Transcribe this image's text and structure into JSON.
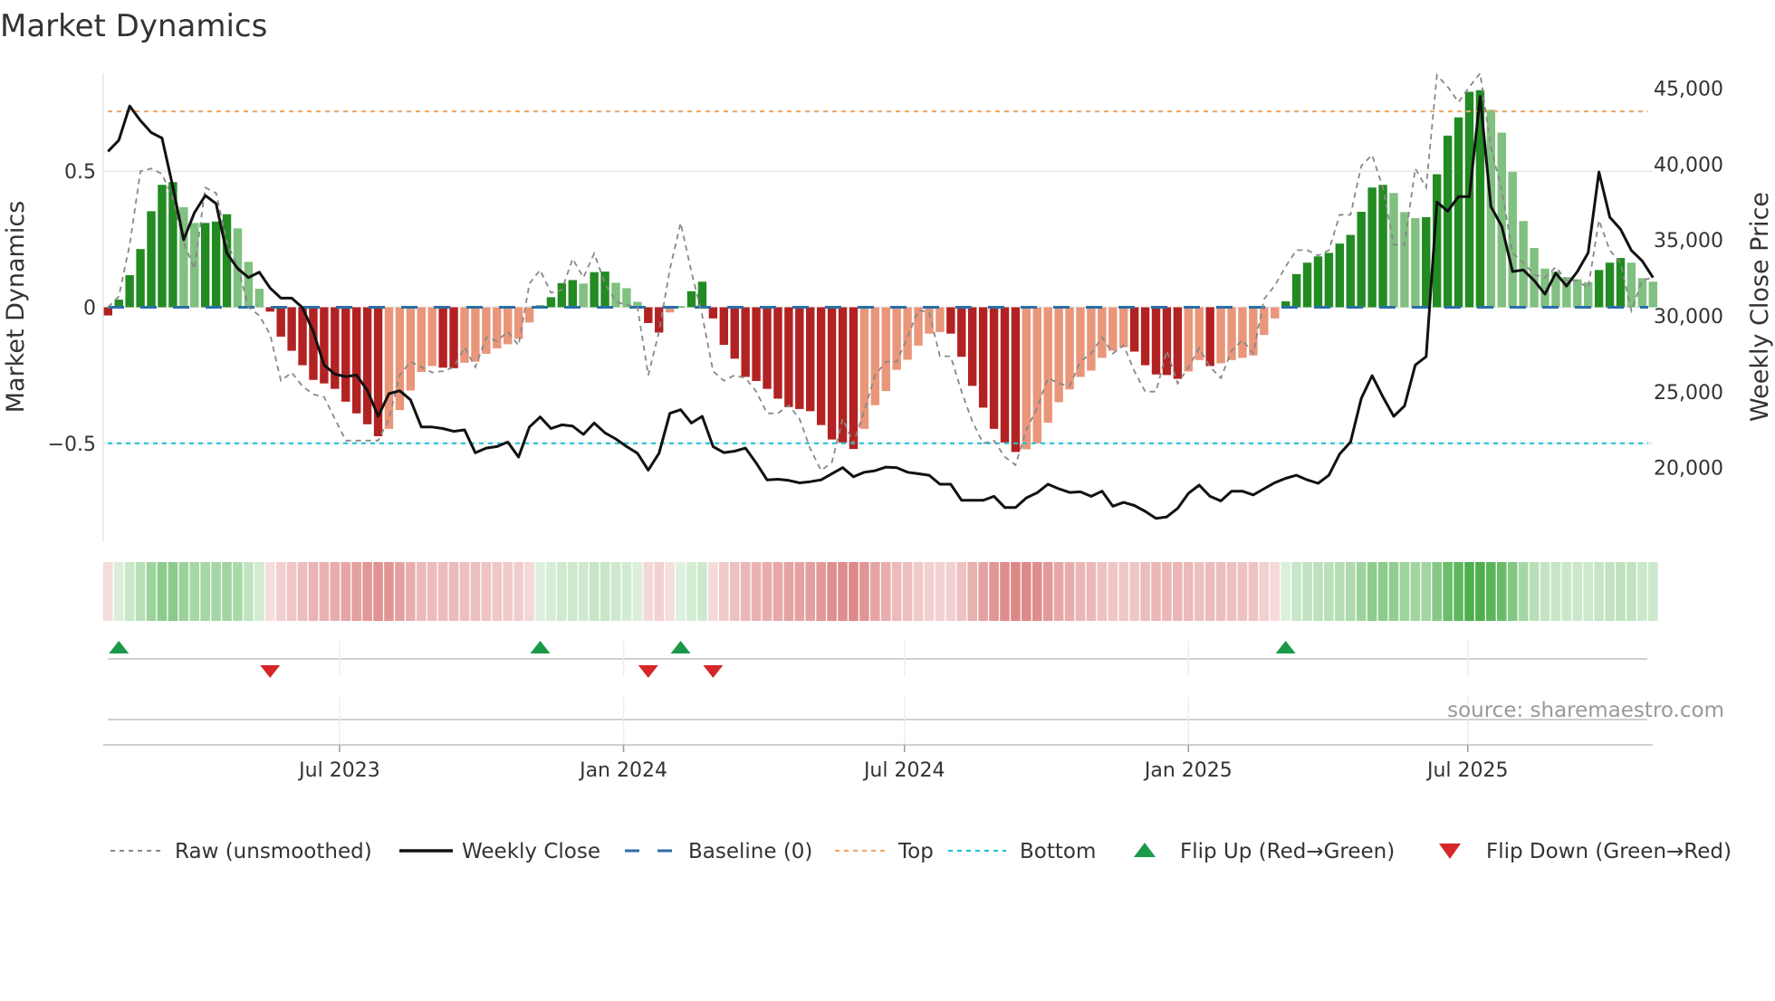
{
  "chart_data": {
    "type": "bar",
    "title": "Market Dynamics",
    "ylabel": "Market Dynamics",
    "y2label": "Weekly Close Price",
    "source": "source: sharemaestro.com",
    "week_start": "2023-02-01",
    "x_step_days": 7,
    "ylim": [
      -0.86,
      0.86
    ],
    "y2lim": [
      15155,
      45978
    ],
    "yticks": [
      {
        "v": 0.5,
        "label": "0.5"
      },
      {
        "v": 0,
        "label": "0"
      },
      {
        "v": -0.5,
        "label": "−0.5"
      }
    ],
    "y2ticks": [
      {
        "v": 45000,
        "label": "45,000"
      },
      {
        "v": 40000,
        "label": "40,000"
      },
      {
        "v": 35000,
        "label": "35,000"
      },
      {
        "v": 30000,
        "label": "30,000"
      },
      {
        "v": 25000,
        "label": "25,000"
      },
      {
        "v": 20000,
        "label": "20,000"
      }
    ],
    "xticks": [
      {
        "date": "2023-07-01",
        "label": "Jul 2023"
      },
      {
        "date": "2024-01-01",
        "label": "Jan 2024"
      },
      {
        "date": "2024-07-01",
        "label": "Jul 2024"
      },
      {
        "date": "2025-01-01",
        "label": "Jan 2025"
      },
      {
        "date": "2025-07-01",
        "label": "Jul 2025"
      }
    ],
    "top_level": 0.72,
    "bottom_level": -0.5,
    "baseline": 0,
    "colors": {
      "green_dark": "#228b22",
      "green_light": "#80c080",
      "red_dark": "#b22222",
      "red_light": "#e9967a",
      "top": "#f0a868",
      "bottom": "#22c4d8",
      "baseline": "#2a6fa8",
      "raw": "#888888",
      "close": "#111111",
      "flip_up": "#1a9a48",
      "flip_down": "#d62728"
    },
    "series": [
      {
        "name": "Market Dynamics",
        "kind": "bar",
        "values": [
          -0.03,
          0.028,
          0.118,
          0.214,
          0.353,
          0.45,
          0.46,
          0.368,
          0.31,
          0.31,
          0.315,
          0.342,
          0.29,
          0.167,
          0.068,
          -0.016,
          -0.108,
          -0.16,
          -0.213,
          -0.267,
          -0.28,
          -0.3,
          -0.347,
          -0.39,
          -0.43,
          -0.474,
          -0.447,
          -0.378,
          -0.306,
          -0.238,
          -0.216,
          -0.222,
          -0.224,
          -0.204,
          -0.2,
          -0.171,
          -0.151,
          -0.136,
          -0.116,
          -0.056,
          0.007,
          0.037,
          0.089,
          0.1,
          0.087,
          0.129,
          0.131,
          0.09,
          0.07,
          0.02,
          -0.058,
          -0.093,
          -0.019,
          0.003,
          0.059,
          0.094,
          -0.041,
          -0.138,
          -0.189,
          -0.256,
          -0.271,
          -0.3,
          -0.336,
          -0.367,
          -0.374,
          -0.382,
          -0.433,
          -0.486,
          -0.497,
          -0.521,
          -0.447,
          -0.36,
          -0.308,
          -0.23,
          -0.193,
          -0.141,
          -0.097,
          -0.091,
          -0.097,
          -0.182,
          -0.289,
          -0.369,
          -0.447,
          -0.497,
          -0.532,
          -0.522,
          -0.5,
          -0.424,
          -0.349,
          -0.302,
          -0.256,
          -0.233,
          -0.186,
          -0.16,
          -0.147,
          -0.163,
          -0.213,
          -0.247,
          -0.249,
          -0.263,
          -0.236,
          -0.194,
          -0.216,
          -0.206,
          -0.194,
          -0.186,
          -0.177,
          -0.102,
          -0.041,
          0.022,
          0.122,
          0.164,
          0.187,
          0.2,
          0.234,
          0.266,
          0.351,
          0.44,
          0.45,
          0.42,
          0.35,
          0.328,
          0.331,
          0.489,
          0.631,
          0.698,
          0.792,
          0.798,
          0.726,
          0.642,
          0.498,
          0.317,
          0.218,
          0.142,
          0.131,
          0.111,
          0.103,
          0.092,
          0.137,
          0.164,
          0.181,
          0.164,
          0.107,
          0.094
        ]
      },
      {
        "name": "Raw (unsmoothed)",
        "kind": "line",
        "values": [
          0,
          0.04,
          0.23,
          0.5,
          0.51,
          0.49,
          0.4,
          0.24,
          0.14,
          0.44,
          0.42,
          0.24,
          0.15,
          0,
          -0.03,
          -0.1,
          -0.27,
          -0.24,
          -0.29,
          -0.32,
          -0.33,
          -0.41,
          -0.49,
          -0.49,
          -0.49,
          -0.49,
          -0.41,
          -0.25,
          -0.2,
          -0.22,
          -0.24,
          -0.235,
          -0.22,
          -0.147,
          -0.22,
          -0.11,
          -0.124,
          -0.09,
          -0.14,
          0.087,
          0.137,
          0.053,
          0.064,
          0.178,
          0.109,
          0.198,
          0.087,
          0.02,
          0.009,
          0,
          -0.25,
          -0.09,
          0.14,
          0.31,
          0.13,
          -0.03,
          -0.235,
          -0.27,
          -0.25,
          -0.26,
          -0.31,
          -0.39,
          -0.39,
          -0.36,
          -0.41,
          -0.52,
          -0.6,
          -0.57,
          -0.41,
          -0.5,
          -0.38,
          -0.25,
          -0.2,
          -0.2,
          -0.11,
          -0.01,
          -0.02,
          -0.18,
          -0.18,
          -0.31,
          -0.42,
          -0.5,
          -0.49,
          -0.55,
          -0.58,
          -0.45,
          -0.37,
          -0.26,
          -0.28,
          -0.29,
          -0.2,
          -0.17,
          -0.11,
          -0.17,
          -0.14,
          -0.235,
          -0.31,
          -0.31,
          -0.16,
          -0.28,
          -0.22,
          -0.15,
          -0.22,
          -0.26,
          -0.16,
          -0.12,
          -0.17,
          0.03,
          0.08,
          0.15,
          0.21,
          0.21,
          0.19,
          0.21,
          0.34,
          0.34,
          0.52,
          0.56,
          0.44,
          0.23,
          0.23,
          0.51,
          0.44,
          0.853,
          0.81,
          0.754,
          0.81,
          0.864,
          0.587,
          0.43,
          0.2,
          0.164,
          0.12,
          0.109,
          0.148,
          0.098,
          0.098,
          0.07,
          0.32,
          0.209,
          0.164,
          -0.013,
          0.098,
          0.11
        ]
      },
      {
        "name": "Weekly Close",
        "kind": "line",
        "axis": "right",
        "values": [
          40830,
          41570,
          43820,
          42860,
          42070,
          41710,
          38490,
          35010,
          36800,
          37930,
          37400,
          34120,
          33120,
          32520,
          32880,
          31830,
          31170,
          31170,
          30540,
          28950,
          26760,
          26160,
          26000,
          26100,
          25100,
          23380,
          24870,
          25070,
          24470,
          22680,
          22680,
          22580,
          22390,
          22490,
          20980,
          21290,
          21390,
          21690,
          20700,
          22680,
          23340,
          22580,
          22820,
          22740,
          22190,
          22940,
          22290,
          21890,
          21390,
          20950,
          19840,
          20950,
          23580,
          23820,
          22940,
          23380,
          21390,
          20990,
          21090,
          21290,
          20300,
          19200,
          19240,
          19160,
          19000,
          19080,
          19200,
          19600,
          20000,
          19400,
          19700,
          19800,
          20040,
          20000,
          19700,
          19600,
          19500,
          18910,
          18910,
          17850,
          17850,
          17850,
          18110,
          17380,
          17380,
          18010,
          18350,
          18910,
          18610,
          18370,
          18410,
          18110,
          18450,
          17460,
          17710,
          17510,
          17120,
          16660,
          16760,
          17320,
          18310,
          18850,
          18110,
          17810,
          18450,
          18450,
          18210,
          18610,
          19010,
          19300,
          19500,
          19200,
          18970,
          19500,
          20900,
          21690,
          24570,
          26060,
          24670,
          23380,
          24070,
          26760,
          27320,
          37500,
          36900,
          37850,
          37850,
          44450,
          37200,
          35900,
          32920,
          33020,
          32330,
          31430,
          32820,
          31970,
          32920,
          34160,
          39480,
          36500,
          35700,
          34310,
          33620,
          32520
        ]
      }
    ],
    "flip_up_weeks": [
      2,
      41,
      54,
      110
    ],
    "flip_down_weeks": [
      16,
      51,
      57
    ],
    "legend": {
      "position": "bottom",
      "items": [
        {
          "label": "Raw (unsmoothed)",
          "kind": "raw"
        },
        {
          "label": "Weekly Close",
          "kind": "close"
        },
        {
          "label": "Baseline (0)",
          "kind": "baseline"
        },
        {
          "label": "Top",
          "kind": "top"
        },
        {
          "label": "Bottom",
          "kind": "bottom"
        },
        {
          "label": "Flip Up (Red→Green)",
          "kind": "up"
        },
        {
          "label": "Flip Down (Green→Red)",
          "kind": "down"
        }
      ]
    }
  }
}
